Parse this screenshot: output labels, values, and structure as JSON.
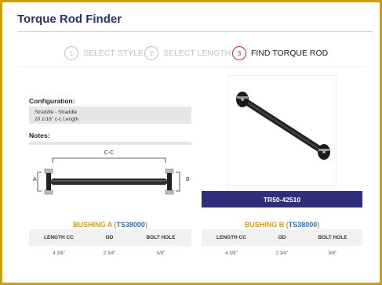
{
  "header": {
    "title": "Torque Rod Finder"
  },
  "steps": [
    {
      "number": "1",
      "label": "SELECT STYLE",
      "state": "done"
    },
    {
      "number": "2",
      "label": "SELECT LENGTH",
      "state": "done"
    },
    {
      "number": "3",
      "label": "FIND TORQUE ROD",
      "state": "active"
    }
  ],
  "configuration": {
    "heading": "Configuration:",
    "lines": [
      "Straddle - Straddle",
      "20 1/16\" c-c Length"
    ]
  },
  "notes": {
    "heading": "Notes:"
  },
  "diagram": {
    "cc_label": "C-C",
    "label_a": "A",
    "label_b": "B"
  },
  "part": {
    "number": "TR50-42510"
  },
  "bushing_a": {
    "title_prefix": "BUSHING A (",
    "link": "TS38000",
    "title_suffix": ")",
    "headers": [
      "LENGTH CC",
      "OD",
      "BOLT HOLE"
    ],
    "values": [
      "4 3/8\"",
      "2 3/4\"",
      "5/8\""
    ]
  },
  "bushing_b": {
    "title_prefix": "BUSHING B (",
    "link": "TS38000",
    "title_suffix": ")",
    "headers": [
      "LENGTH CC",
      "OD",
      "BOLT HOLE"
    ],
    "values": [
      "4 3/8\"",
      "2 3/4\"",
      "5/8\""
    ]
  },
  "colors": {
    "accent": "#2e2f78",
    "active_step": "#c1272d",
    "bushing_title": "#d99a2b",
    "link": "#2b6fba",
    "border": "#c9a200"
  }
}
